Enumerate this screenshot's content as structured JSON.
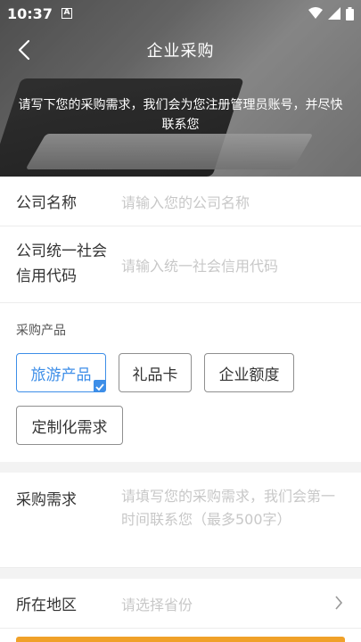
{
  "status_bar": {
    "time": "10:37",
    "badge": "A"
  },
  "header": {
    "title": "企业采购",
    "description": "请写下您的采购需求，我们会为您注册管理员账号，并尽快联系您"
  },
  "form": {
    "company_name": {
      "label": "公司名称",
      "placeholder": "请输入您的公司名称"
    },
    "credit_code": {
      "label_line1": "公司统一社会",
      "label_line2": "信用代码",
      "placeholder": "请输入统一社会信用代码"
    },
    "products": {
      "title": "采购产品",
      "options": [
        "旅游产品",
        "礼品卡",
        "企业额度",
        "定制化需求"
      ],
      "selected": "旅游产品"
    },
    "requirement": {
      "label": "采购需求",
      "placeholder": "请填写您的采购需求，我们会第一时间联系您（最多500字）"
    },
    "region": {
      "label": "所在地区",
      "placeholder": "请选择省份"
    }
  },
  "colors": {
    "accent": "#3d8ee8",
    "submit_bar": "#f0a129"
  }
}
